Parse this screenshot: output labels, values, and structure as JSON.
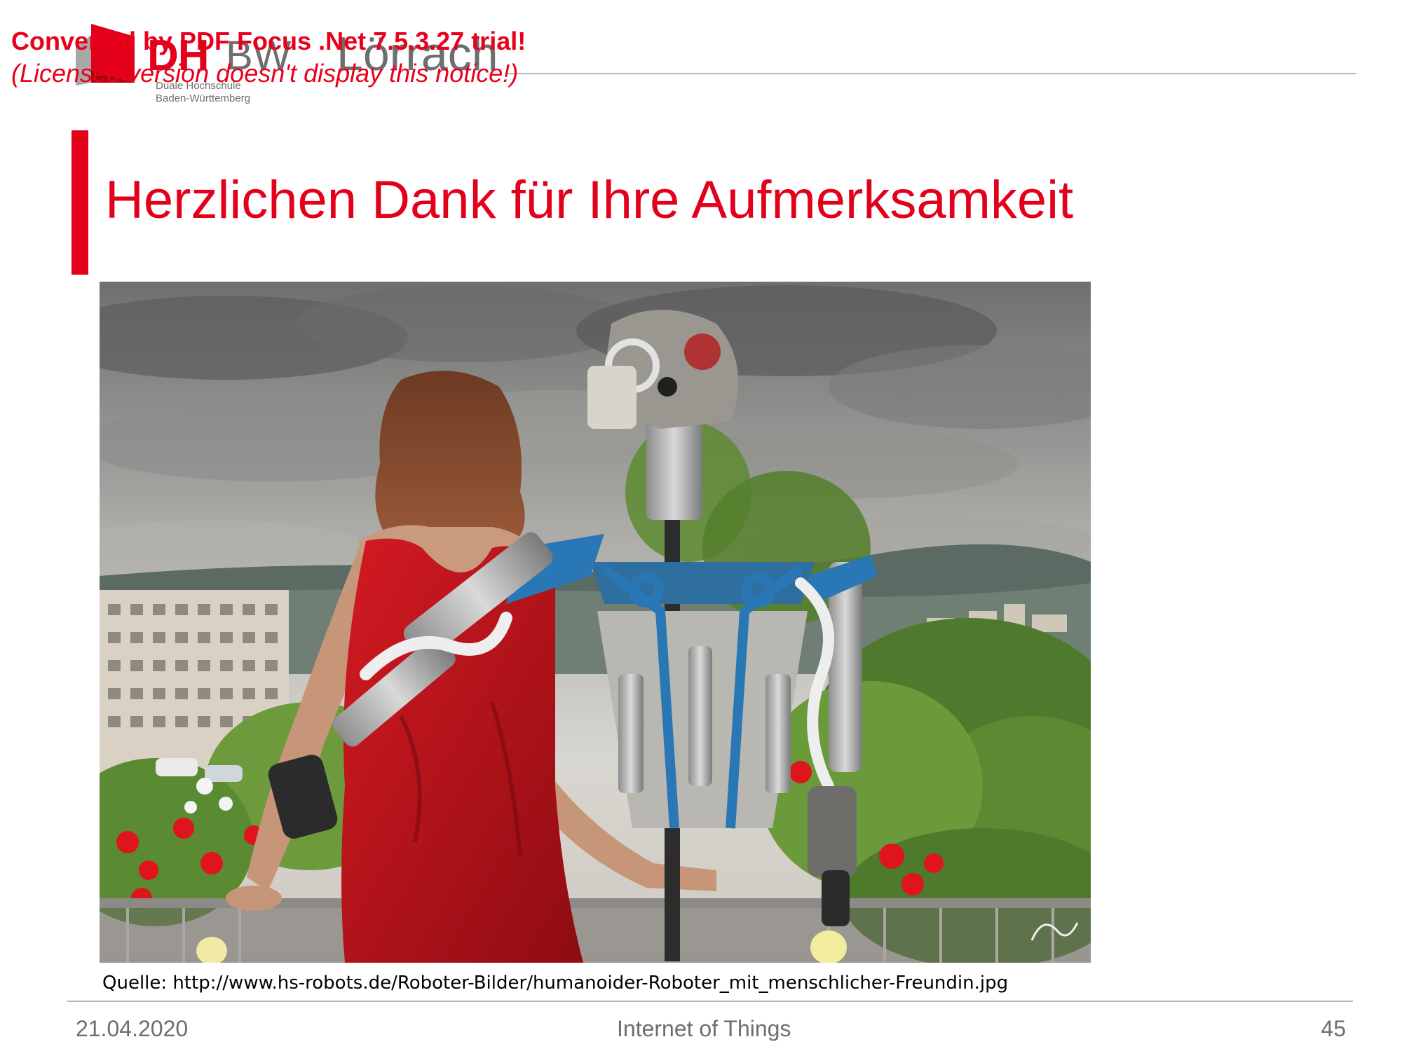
{
  "watermark": {
    "line1": "Converted by PDF Focus .Net 7.5.3.27 trial!",
    "line2": "(Licensed version doesn't display this notice!)"
  },
  "logo": {
    "dh": "DH",
    "bw": "BW",
    "city": "Lörrach",
    "sub_line1": "Duale Hochschule",
    "sub_line2": "Baden-Württemberg",
    "brand_color": "#e2001a"
  },
  "slide": {
    "title": "Herzlichen Dank für Ihre Aufmerksamkeit",
    "caption": "Quelle: http://www.hs-robots.de/Roboter-Bilder/humanoider-Roboter_mit_menschlicher-Freundin.jpg",
    "accent_color": "#e2001a"
  },
  "footer": {
    "date": "21.04.2020",
    "title": "Internet of Things",
    "page": "45"
  }
}
